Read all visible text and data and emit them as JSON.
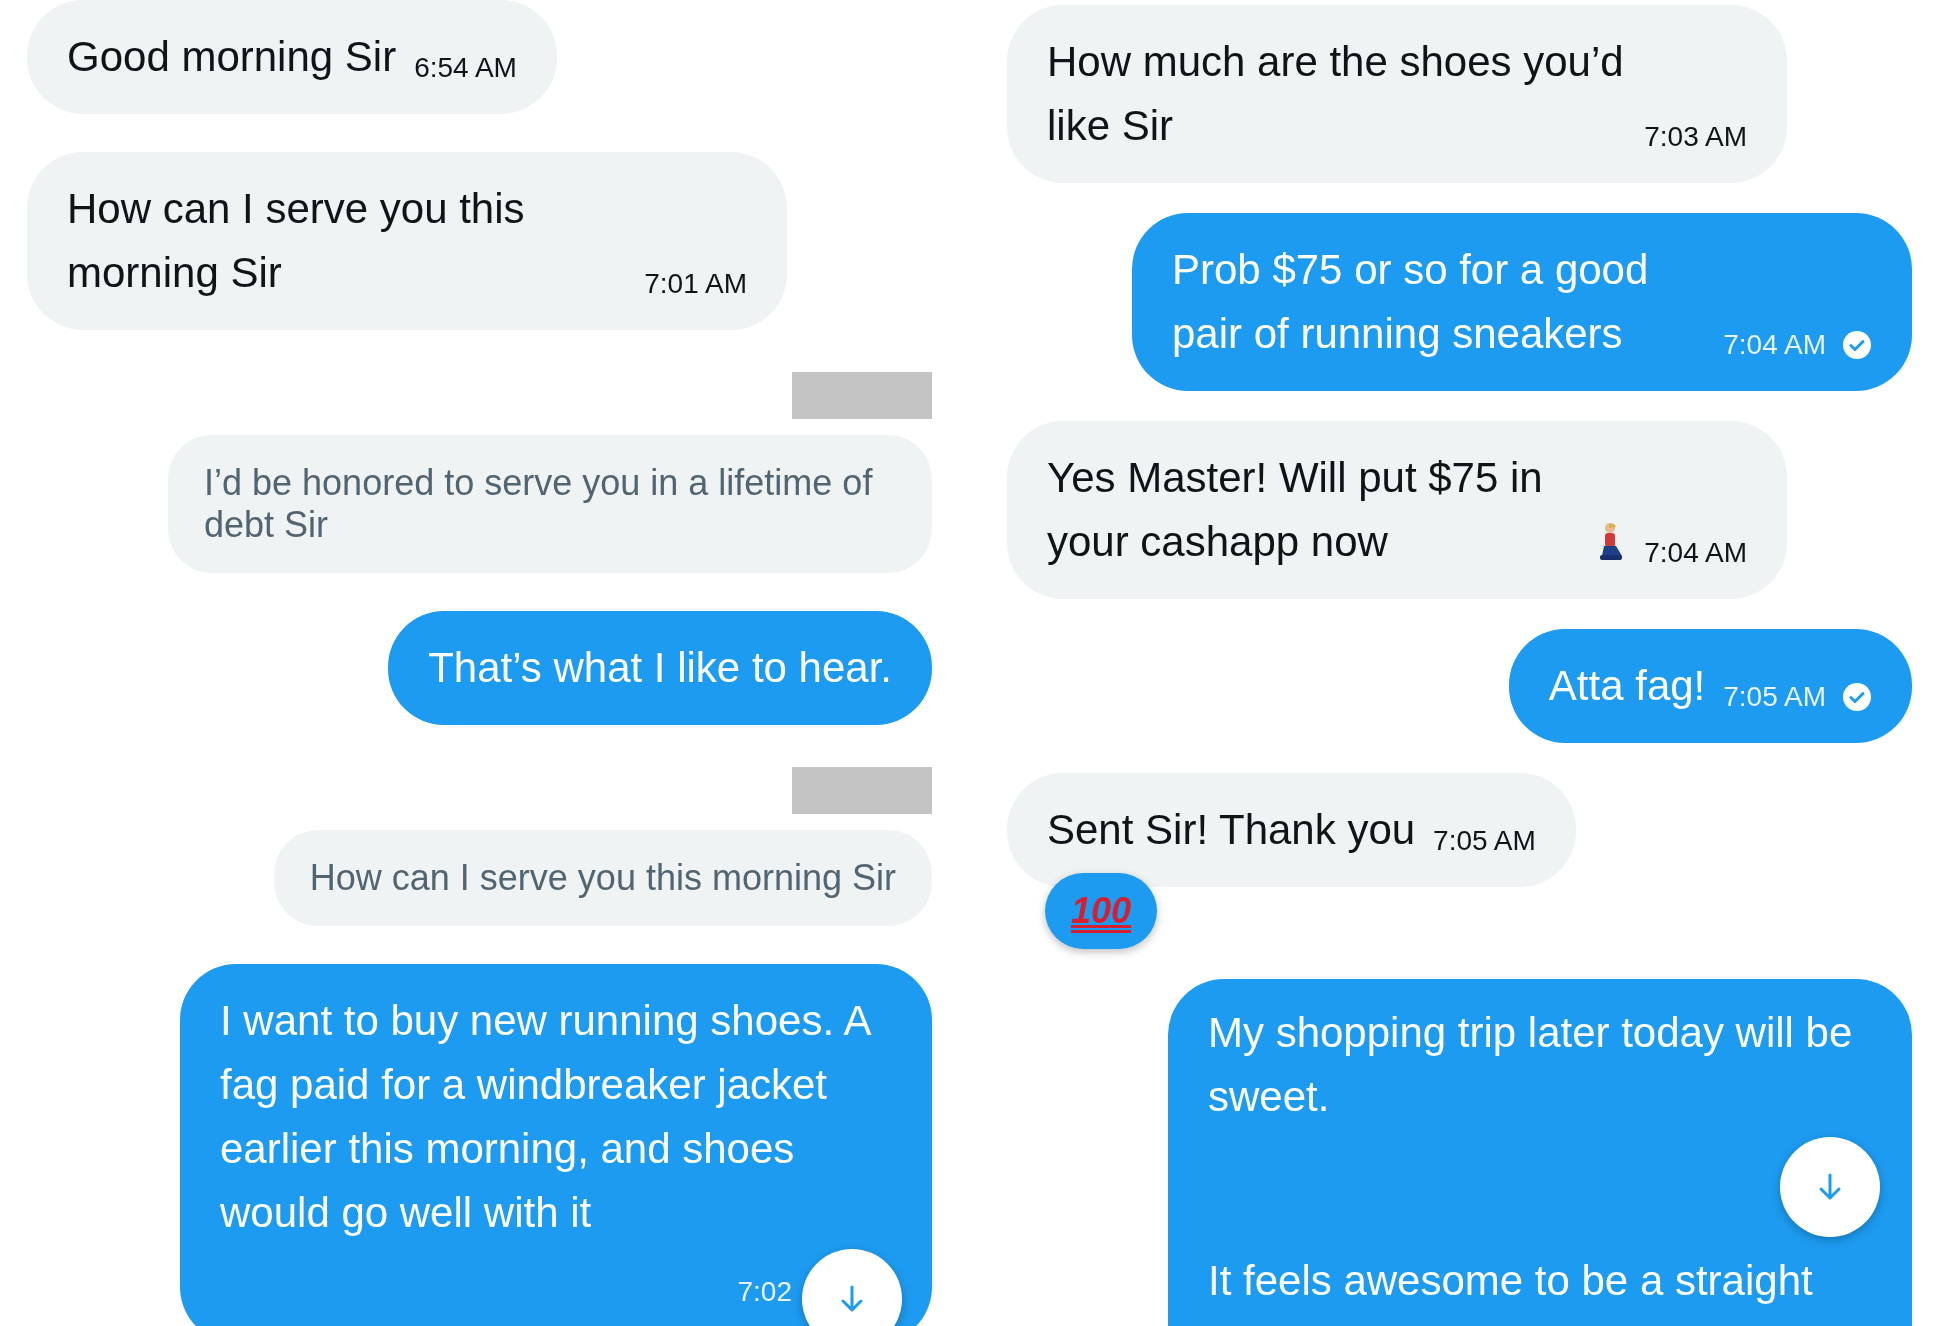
{
  "columns": [
    {
      "messages": [
        {
          "kind": "received",
          "text": "Good morning Sir",
          "time": "6:54 AM"
        },
        {
          "kind": "received",
          "text": "How can I serve you this morning Sir",
          "time": "7:01 AM"
        },
        {
          "kind": "quote",
          "text": "I’d be honored to serve you in a lifetime of debt Sir"
        },
        {
          "kind": "sent",
          "text": "That’s what I like to hear.",
          "read": false
        },
        {
          "kind": "quote",
          "text": "How can I serve you this morning Sir"
        },
        {
          "kind": "sent",
          "text": "I want to buy new running shoes. A fag paid for a windbreaker jacket earlier this morning, and shoes would go well with it",
          "time": "7:02",
          "read": false,
          "jump_button": true
        }
      ]
    },
    {
      "messages": [
        {
          "kind": "received",
          "text": "How much are the shoes you’d like Sir",
          "time": "7:03 AM"
        },
        {
          "kind": "sent",
          "text": "Prob $75 or so for a good pair of running sneakers",
          "time": "7:04 AM",
          "read": true
        },
        {
          "kind": "received",
          "text": "Yes Master! Will put $75 in your cashapp now",
          "emoji": true,
          "time": "7:04 AM"
        },
        {
          "kind": "sent",
          "text": "Atta fag!",
          "time": "7:05 AM",
          "read": true
        },
        {
          "kind": "received",
          "text": "Sent Sir! Thank you",
          "time": "7:05 AM",
          "reaction": "100"
        },
        {
          "kind": "sent",
          "paragraphs": [
            "My shopping trip later today will be sweet.",
            "It feels awesome to be a straight"
          ],
          "read": false,
          "jump_button": true
        }
      ]
    }
  ]
}
